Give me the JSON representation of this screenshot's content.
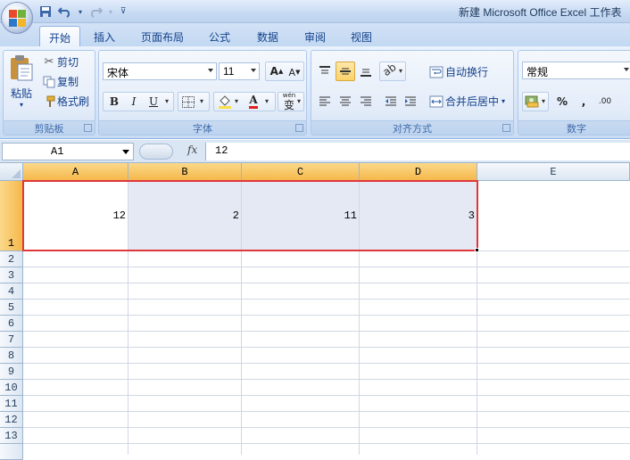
{
  "window": {
    "title": "新建 Microsoft Office Excel 工作表"
  },
  "quick_access": {
    "items": [
      "save-icon",
      "undo-icon",
      "redo-icon",
      "customize-icon"
    ]
  },
  "tabs": [
    {
      "label": "开始",
      "active": true
    },
    {
      "label": "插入",
      "active": false
    },
    {
      "label": "页面布局",
      "active": false
    },
    {
      "label": "公式",
      "active": false
    },
    {
      "label": "数据",
      "active": false
    },
    {
      "label": "审阅",
      "active": false
    },
    {
      "label": "视图",
      "active": false
    }
  ],
  "ribbon": {
    "clipboard": {
      "label": "剪贴板",
      "paste": "粘贴",
      "cut": "剪切",
      "copy": "复制",
      "format_painter": "格式刷"
    },
    "font": {
      "label": "字体",
      "font_name": "宋体",
      "font_size": "11",
      "grow": "A",
      "shrink": "A",
      "bold": "B",
      "italic": "I",
      "underline": "U",
      "font_color_glyph": "A",
      "phonetic": "wén",
      "phonetic_glyph": "变",
      "font_color": "#e0201b",
      "fill_color": "#f6e04b"
    },
    "alignment": {
      "label": "对齐方式",
      "wrap_text": "自动换行",
      "merge_center": "合并后居中"
    },
    "number": {
      "label": "数字",
      "format": "常规",
      "percent": "%",
      "comma": ",",
      "inc_decimal": ".00"
    }
  },
  "formula_bar": {
    "name_box": "A1",
    "fx": "fx",
    "value": "12"
  },
  "sheet": {
    "columns": [
      "A",
      "B",
      "C",
      "D",
      "E"
    ],
    "selected_columns": [
      "A",
      "B",
      "C",
      "D"
    ],
    "rows": [
      "1",
      "2",
      "3",
      "4",
      "5",
      "6",
      "7",
      "8",
      "9",
      "10",
      "11",
      "12",
      "13"
    ],
    "selected_rows": [
      "1"
    ],
    "cells": {
      "A1": "12",
      "B1": "2",
      "C1": "11",
      "D1": "3"
    },
    "selection_color": "#e0373b"
  }
}
